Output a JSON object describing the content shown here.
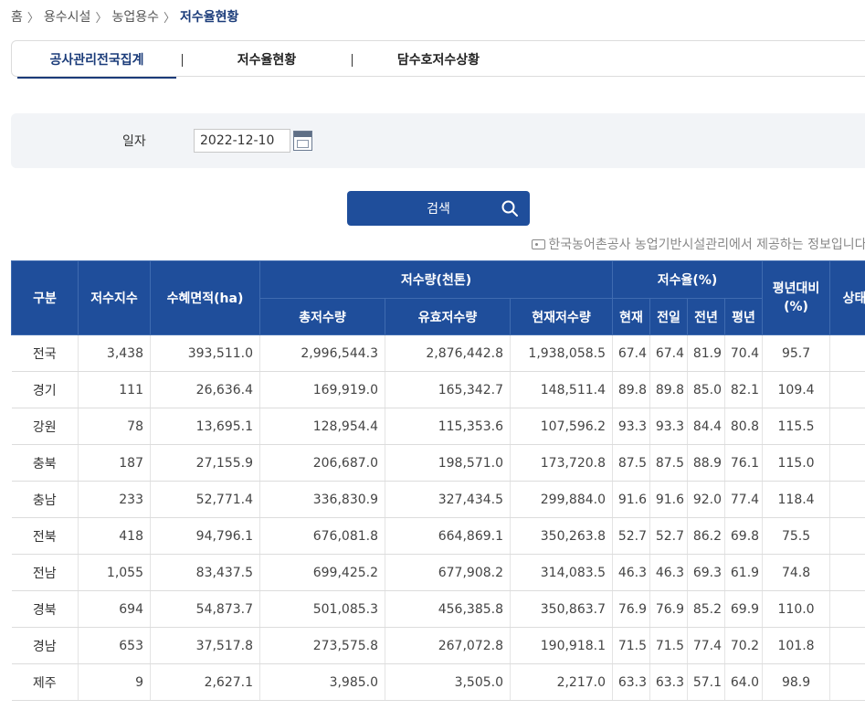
{
  "breadcrumb": {
    "home": "홈",
    "level1": "용수시설",
    "level2": "농업용수",
    "current": "저수율현황",
    "separator": "〉"
  },
  "tabs": [
    "공사관리전국집계",
    "저수율현황",
    "담수호저수상황"
  ],
  "search": {
    "date_label": "일자",
    "date_value": "2022-12-10",
    "button_label": "검색"
  },
  "source_note": "한국농어촌공사 농업기반시설관리에서 제공하는 정보입니다.",
  "table": {
    "headers": {
      "region": "구분",
      "count": "저수지수",
      "area": "수혜면적(ha)",
      "storage": "저수량(천톤)",
      "total": "총저수량",
      "effective": "유효저수량",
      "current": "현재저수량",
      "rate": "저수율(%)",
      "now": "현재",
      "prev_day": "전일",
      "prev_year": "전년",
      "avg_year": "평년",
      "vs_avg": "평년대비\n(%)",
      "status": "상태"
    },
    "rows": [
      {
        "region": "전국",
        "count": "3,438",
        "area": "393,511.0",
        "total": "2,996,544.3",
        "effective": "2,876,442.8",
        "current": "1,938,058.5",
        "now": "67.4",
        "prev_day": "67.4",
        "prev_year": "81.9",
        "avg_year": "70.4",
        "vs_avg": "95.7",
        "status": ""
      },
      {
        "region": "경기",
        "count": "111",
        "area": "26,636.4",
        "total": "169,919.0",
        "effective": "165,342.7",
        "current": "148,511.4",
        "now": "89.8",
        "prev_day": "89.8",
        "prev_year": "85.0",
        "avg_year": "82.1",
        "vs_avg": "109.4",
        "status": ""
      },
      {
        "region": "강원",
        "count": "78",
        "area": "13,695.1",
        "total": "128,954.4",
        "effective": "115,353.6",
        "current": "107,596.2",
        "now": "93.3",
        "prev_day": "93.3",
        "prev_year": "84.4",
        "avg_year": "80.8",
        "vs_avg": "115.5",
        "status": ""
      },
      {
        "region": "충북",
        "count": "187",
        "area": "27,155.9",
        "total": "206,687.0",
        "effective": "198,571.0",
        "current": "173,720.8",
        "now": "87.5",
        "prev_day": "87.5",
        "prev_year": "88.9",
        "avg_year": "76.1",
        "vs_avg": "115.0",
        "status": ""
      },
      {
        "region": "충남",
        "count": "233",
        "area": "52,771.4",
        "total": "336,830.9",
        "effective": "327,434.5",
        "current": "299,884.0",
        "now": "91.6",
        "prev_day": "91.6",
        "prev_year": "92.0",
        "avg_year": "77.4",
        "vs_avg": "118.4",
        "status": ""
      },
      {
        "region": "전북",
        "count": "418",
        "area": "94,796.1",
        "total": "676,081.8",
        "effective": "664,869.1",
        "current": "350,263.8",
        "now": "52.7",
        "prev_day": "52.7",
        "prev_year": "86.2",
        "avg_year": "69.8",
        "vs_avg": "75.5",
        "status": ""
      },
      {
        "region": "전남",
        "count": "1,055",
        "area": "83,437.5",
        "total": "699,425.2",
        "effective": "677,908.2",
        "current": "314,083.5",
        "now": "46.3",
        "prev_day": "46.3",
        "prev_year": "69.3",
        "avg_year": "61.9",
        "vs_avg": "74.8",
        "status": ""
      },
      {
        "region": "경북",
        "count": "694",
        "area": "54,873.7",
        "total": "501,085.3",
        "effective": "456,385.8",
        "current": "350,863.7",
        "now": "76.9",
        "prev_day": "76.9",
        "prev_year": "85.2",
        "avg_year": "69.9",
        "vs_avg": "110.0",
        "status": ""
      },
      {
        "region": "경남",
        "count": "653",
        "area": "37,517.8",
        "total": "273,575.8",
        "effective": "267,072.8",
        "current": "190,918.1",
        "now": "71.5",
        "prev_day": "71.5",
        "prev_year": "77.4",
        "avg_year": "70.2",
        "vs_avg": "101.8",
        "status": ""
      },
      {
        "region": "제주",
        "count": "9",
        "area": "2,627.1",
        "total": "3,985.0",
        "effective": "3,505.0",
        "current": "2,217.0",
        "now": "63.3",
        "prev_day": "63.3",
        "prev_year": "57.1",
        "avg_year": "64.0",
        "vs_avg": "98.9",
        "status": ""
      }
    ]
  }
}
